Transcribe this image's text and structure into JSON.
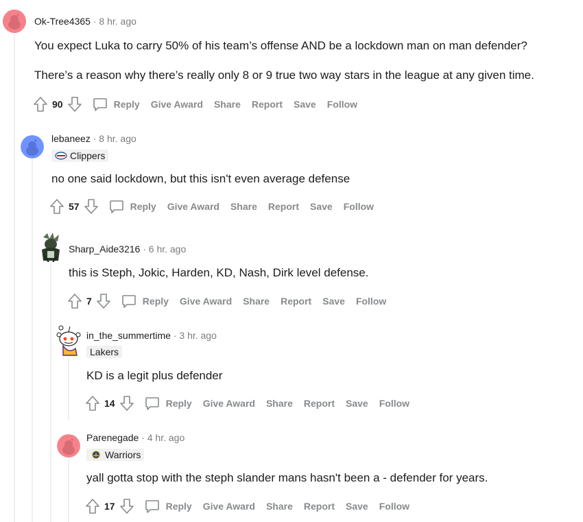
{
  "comments": [
    {
      "user": "Ok-Tree4365",
      "time": "8 hr. ago",
      "flair": null,
      "body": [
        "You expect Luka to carry 50% of his team’s offense AND be a lockdown man on man defender?",
        "There’s a reason why there’s really only 8 or 9 true two way stars in the league at any given time."
      ],
      "score": "90",
      "avatar_color": "#f5828b"
    },
    {
      "user": "lebaneez",
      "time": "8 hr. ago",
      "flair": "Clippers",
      "body": [
        "no one said lockdown, but this isn't even average defense"
      ],
      "score": "57",
      "avatar_color": "#7193ff"
    },
    {
      "user": "Sharp_Aide3216",
      "time": "6 hr. ago",
      "flair": null,
      "body": [
        "this is Steph, Jokic, Harden, KD, Nash, Dirk level defense."
      ],
      "score": "7",
      "avatar_color": "#2c3b2a"
    },
    {
      "user": "in_the_summertime",
      "time": "3 hr. ago",
      "flair": "Lakers",
      "body": [
        "KD is a legit plus defender"
      ],
      "score": "14",
      "avatar_color": "#ffffff"
    },
    {
      "user": "Parenegade",
      "time": "4 hr. ago",
      "flair": "Warriors",
      "body": [
        "yall gotta stop with the steph slander mans hasn't been a - defender for years."
      ],
      "score": "17",
      "avatar_color": "#f5828b"
    }
  ],
  "actions": {
    "reply": "Reply",
    "give_award": "Give Award",
    "share": "Share",
    "report": "Report",
    "save": "Save",
    "follow": "Follow"
  },
  "separator": "·",
  "colors": {
    "meta_gray": "#7c7c7c",
    "action_gray": "#878a8c",
    "thread_line": "#edeff1",
    "flair_bg": "#f1f1f1"
  }
}
